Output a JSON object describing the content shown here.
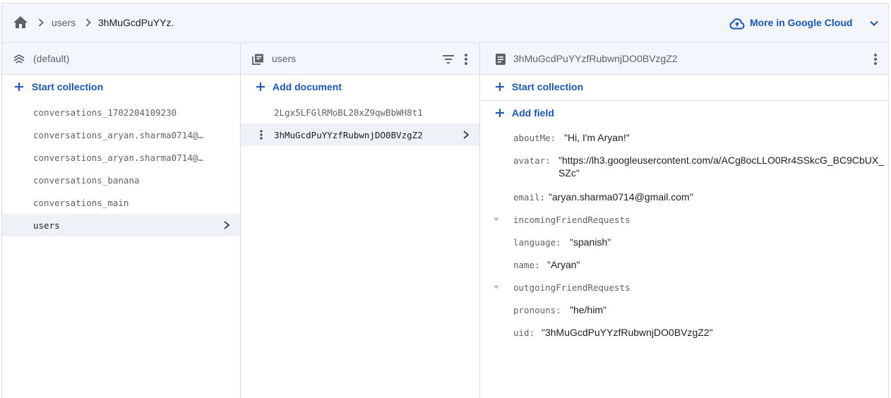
{
  "breadcrumb": {
    "home_icon": "home-icon",
    "items": [
      "users",
      "3hMuGcdPuYYz."
    ]
  },
  "cloud_link": {
    "label": "More in Google Cloud",
    "icon": "cloud-icon"
  },
  "colors": {
    "accent": "#1a56b8",
    "header_bg": "#f3f6fc",
    "selected_bg": "#eef1f6",
    "divider": "#dadce0"
  },
  "col1": {
    "title": "(default)",
    "action_label": "Start collection",
    "items": [
      "conversations_1702204109230",
      "conversations_aryan.sharma0714@…",
      "conversations_aryan.sharma0714@…",
      "conversations_banana",
      "conversations_main",
      "users"
    ]
  },
  "col2": {
    "title": "users",
    "action_label": "Add document",
    "items": [
      "2Lgx5LFGlRMoBL28xZ9qwBbWH8t1",
      "3hMuGcdPuYYzfRubwnjDO0BVzgZ2"
    ]
  },
  "col3": {
    "title": "3hMuGcdPuYYzfRubwnjDO0BVzgZ2",
    "start_collection_label": "Start collection",
    "add_field_label": "Add field",
    "fields": [
      {
        "key": "aboutMe:",
        "value": "\"Hi, I'm Aryan!\""
      },
      {
        "key": "avatar:",
        "value": "\"https://lh3.googleusercontent.com/a/ACg8ocLLO0Rr4SSkcG_BC9CbUX_SZc\""
      },
      {
        "key": "email:",
        "value": "\"aryan.sharma0714@gmail.com\""
      },
      {
        "key": "incomingFriendRequests",
        "value": ""
      },
      {
        "key": "language:",
        "value": "\"spanish\""
      },
      {
        "key": "name:",
        "value": "\"Aryan\""
      },
      {
        "key": "outgoingFriendRequests",
        "value": ""
      },
      {
        "key": "pronouns:",
        "value": "\"he/him\""
      },
      {
        "key": "uid:",
        "value": "\"3hMuGcdPuYYzfRubwnjDO0BVzgZ2\""
      }
    ]
  }
}
